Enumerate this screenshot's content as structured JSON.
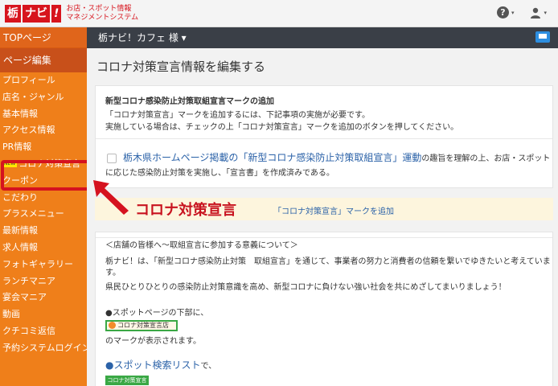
{
  "header": {
    "logo_mark_1": "栃",
    "logo_mark_2": "ナビ",
    "logo_mark_3": "!",
    "logo_sub_1": "お店・スポット情報",
    "logo_sub_2": "マネジメントシステム",
    "help_icon": "?",
    "user_icon": "user-icon",
    "caret": "▾"
  },
  "sidebar": {
    "top_label": "TOPページ",
    "current_label": "ページ編集",
    "items": [
      {
        "label": "プロフィール"
      },
      {
        "label": "店名・ジャンル"
      },
      {
        "label": "基本情報"
      },
      {
        "label": "アクセス情報"
      },
      {
        "label": "PR情報"
      },
      {
        "label": "コロナ対策宣言",
        "badge": "NEW"
      },
      {
        "label": "クーポン"
      },
      {
        "label": "こだわり"
      },
      {
        "label": "プラスメニュー"
      },
      {
        "label": "最新情報"
      },
      {
        "label": "求人情報"
      },
      {
        "label": "フォトギャラリー"
      },
      {
        "label": "ランチマニア"
      },
      {
        "label": "宴会マニア"
      },
      {
        "label": "動画"
      },
      {
        "label": "クチコミ返信"
      },
      {
        "label": "予約システムログイン"
      }
    ]
  },
  "topnav": {
    "shop_name": "栃ナビ！カフェ 様 ▾"
  },
  "main": {
    "page_title": "コロナ対策宣言情報を編集する",
    "section1": {
      "title": "新型コロナ感染防止対策取組宣言マークの追加",
      "desc_1": "「コロナ対策宣言」マークを追加するには、下記事項の実施が必要です。",
      "desc_2": "実施している場合は、チェックの上「コロナ対策宣言」マークを追加のボタンを押してください。",
      "link_text": "栃木県ホームページ掲載の「新型コロナ感染防止対策取組宣言」運動",
      "line1_rest": "の趣旨を理解の上、お店・スポット",
      "line2": "に応じた感染防止対策を実施し、「宣言書」を作成済みである。"
    },
    "callout_label": "コロナ対策宣言",
    "add_link": "「コロナ対策宣言」マークを追加",
    "section2": {
      "heading": "＜店舗の皆様へ～取組宣言に参加する意義について＞",
      "para_1": "栃ナビ！は、「新型コロナ感染防止対策　取組宣言」を通じて、事業者の努力と消費者の信頼を繋いでゆきたいと考えていま",
      "para_1b": "す。",
      "para_2": "県民ひとりひとりの感染防止対策意識を高め、新型コロナに負けない強い社会を共にめざしてまいりましょう！",
      "bullet_1": "●スポットページの下部に、",
      "badge_1": "コロナ対策宣言店",
      "bullet_1b": "のマークが表示されます。",
      "bullet_2_link": "●スポット検索リスト",
      "bullet_2_rest": "で、",
      "badge_2": "コロナ対策宣言"
    }
  },
  "colors": {
    "sidebar": "#ef7f1a",
    "highlight": "#d5121f",
    "link": "#2b62a8",
    "darkbar": "#3a3f47"
  }
}
